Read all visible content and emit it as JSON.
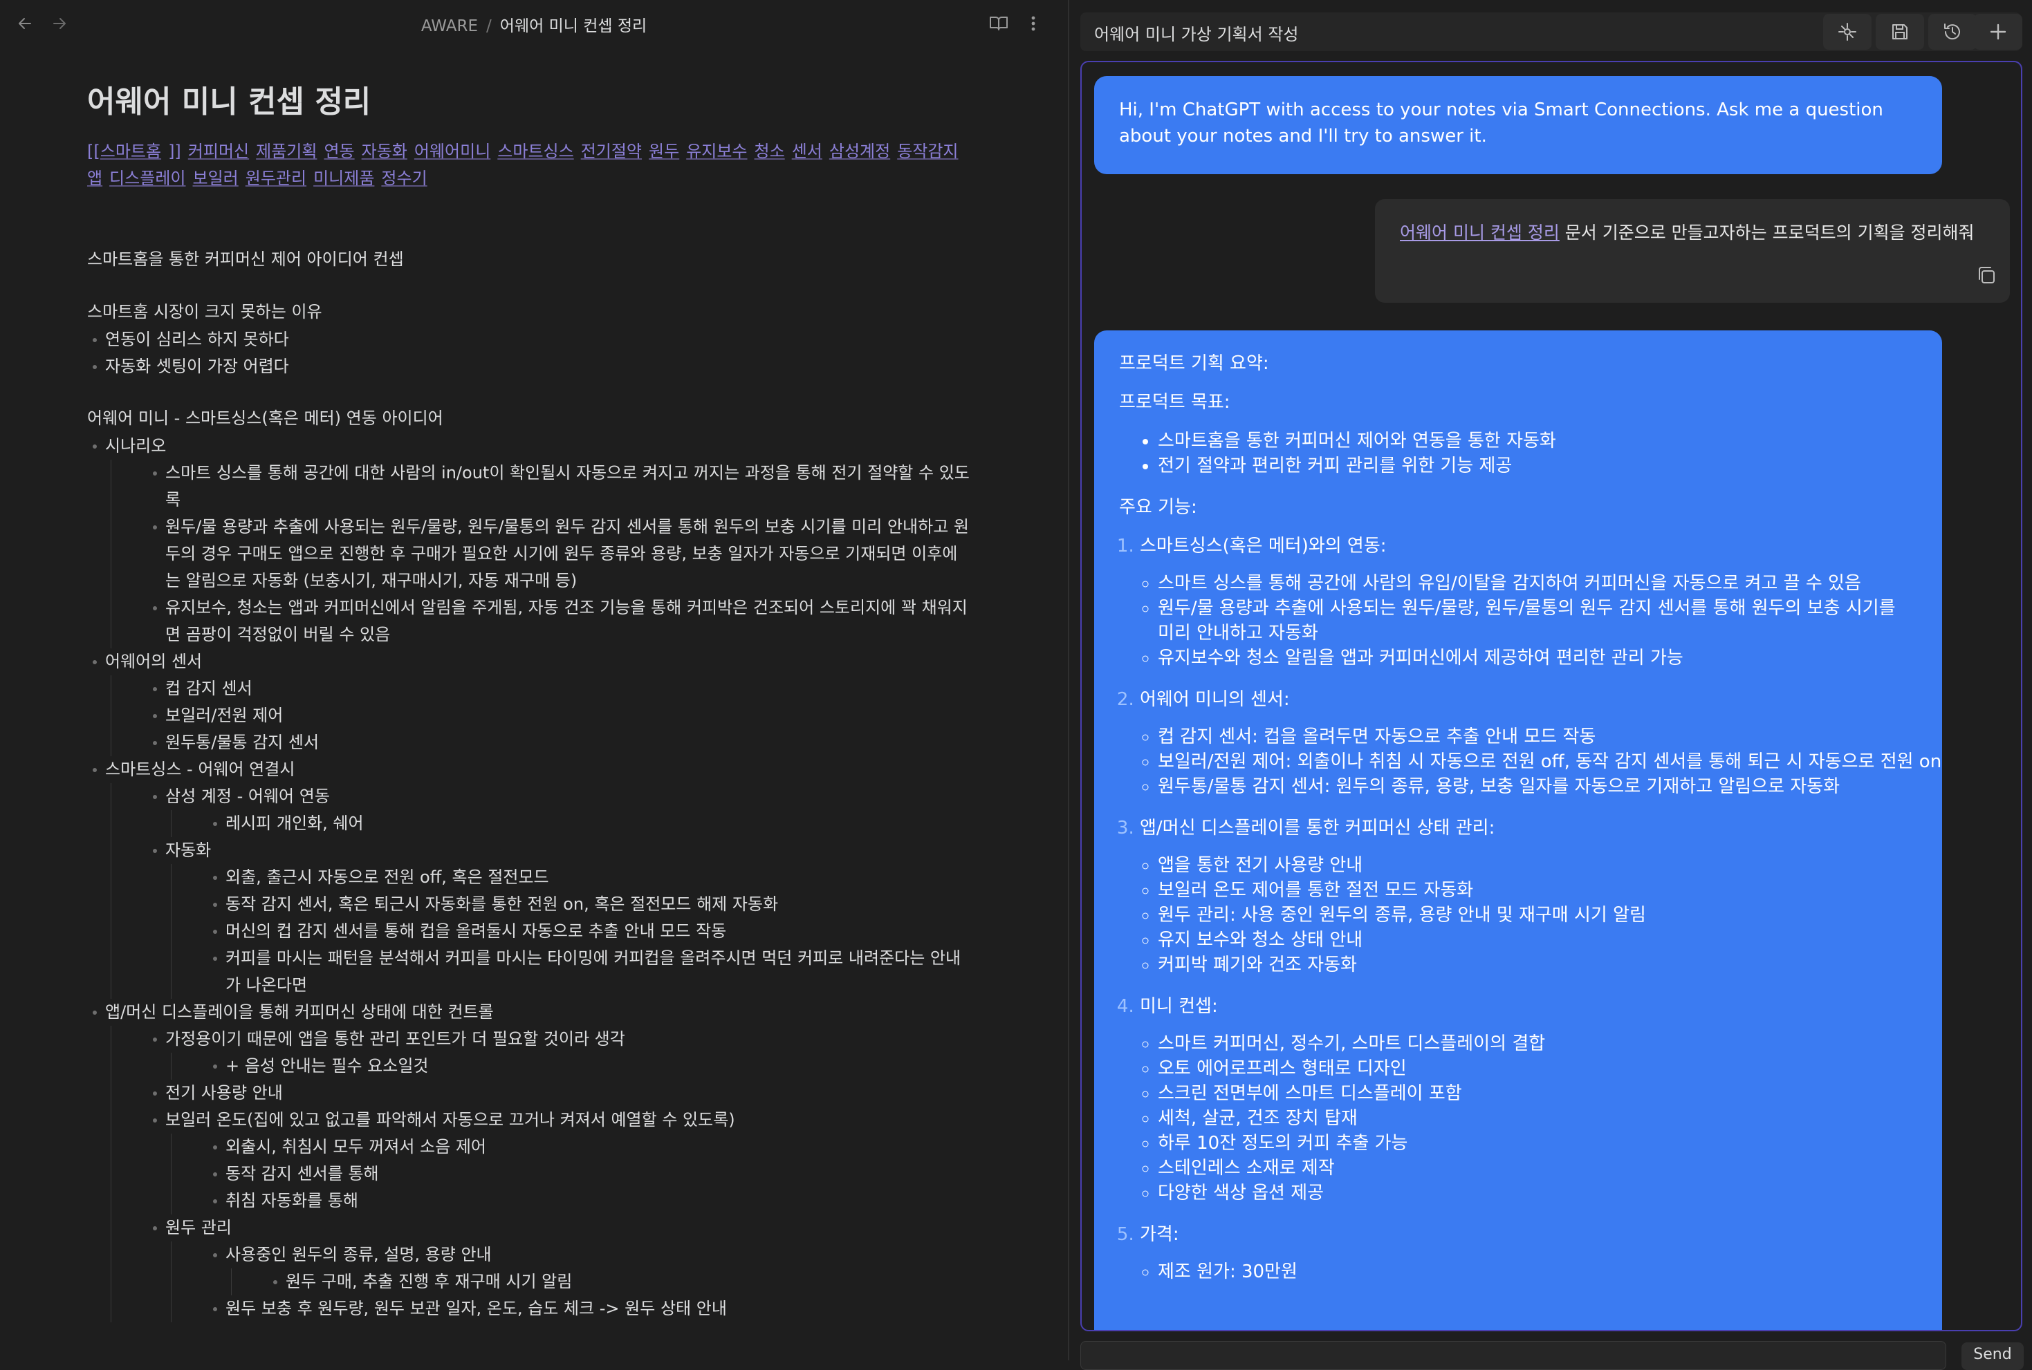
{
  "header": {
    "breadcrumb_root": "AWARE",
    "breadcrumb_sep": "/",
    "breadcrumb_current": "어웨어 미니 컨셉 정리"
  },
  "note": {
    "title": "어웨어 미니 컨셉 정리",
    "tags_open": "[[",
    "tags_first": "스마트홈",
    "tags_close": "]]",
    "tags": [
      "커피머신",
      "제품기획",
      "연동",
      "자동화",
      "어웨어미니",
      "스마트싱스",
      "전기절약",
      "원두",
      "유지보수",
      "청소",
      "센서",
      "삼성계정",
      "동작감지",
      "앱",
      "디스플레이",
      "보일러",
      "원두관리",
      "미니제품",
      "정수기"
    ],
    "intro": "스마트홈을 통한 커피머신 제어 아이디어 컨셉",
    "why_title": "스마트홈 시장이 크지 못하는 이유",
    "why_items": [
      "연동이 심리스 하지 못하다",
      "자동화 셋팅이 가장 어렵다"
    ],
    "idea_title": "어웨어 미니 - 스마트싱스(혹은 메터) 연동 아이디어",
    "l_scenario": "시나리오",
    "l_scenario_1": "스마트 싱스를 통해 공간에 대한 사람의 in/out이 확인될시  자동으로 켜지고 꺼지는 과정을 통해 전기 절약할 수 있도록",
    "l_scenario_2": "원두/물 용량과 추출에 사용되는 원두/물량, 원두/물통의 원두 감지 센서를 통해 원두의 보충 시기를 미리 안내하고 원두의 경우 구매도 앱으로 진행한 후 구매가 필요한 시기에 원두 종류와 용량, 보충 일자가 자동으로 기재되면 이후에는 알림으로 자동화 (보충시기, 재구매시기, 자동 재구매 등)",
    "l_scenario_3": "유지보수, 청소는 앱과 커피머신에서 알림을 주게됨, 자동 건조 기능을 통해 커피박은 건조되어 스토리지에 꽉 채워지면 곰팡이 걱정없이 버릴 수 있음",
    "l_sensor": "어웨어의 센서",
    "l_sensor_1": "컵 감지 센서",
    "l_sensor_2": "보일러/전원 제어",
    "l_sensor_3": "원두통/물통 감지 센서",
    "l_st": "스마트싱스 - 어웨어 연결시",
    "l_st_1": "삼성 계정 - 어웨어 연동",
    "l_st_1_1": "레시피 개인화, 쉐어",
    "l_st_2": "자동화",
    "l_st_2_1": "외출, 출근시 자동으로 전원 off, 혹은 절전모드",
    "l_st_2_2": "동작 감지 센서, 혹은 퇴근시 자동화를 통한 전원 on, 혹은 절전모드 해제 자동화",
    "l_st_2_3": "머신의 컵 감지 센서를 통해 컵을 올려둘시 자동으로 추출 안내 모드 작동",
    "l_st_2_4": "커피를 마시는 패턴을 분석해서 커피를 마시는 타이밍에 커피컵을 올려주시면 먹던 커피로 내려준다는 안내가 나온다면",
    "l_app": "앱/머신 디스플레이을 통해 커피머신 상태에 대한 컨트롤",
    "l_app_1": "가정용이기 때문에 앱을 통한 관리 포인트가 더 필요할 것이라 생각",
    "l_app_1_1": "+ 음성 안내는 필수 요소일것",
    "l_app_2": "전기 사용량 안내",
    "l_app_3": "보일러 온도(집에 있고 없고를 파악해서 자동으로 끄거나 켜져서 예열할 수 있도록)",
    "l_app_3_1": "외출시, 취침시 모두 꺼져서 소음 제어",
    "l_app_3_2": "동작 감지 센서를 통해",
    "l_app_3_3": "취침 자동화를 통해",
    "l_app_4": "원두 관리",
    "l_app_4_1": "사용중인 원두의 종류, 설명, 용량 안내",
    "l_app_4_1_1": "원두 구매, 추출 진행 후 재구매 시기 알림",
    "l_app_4_2": "원두 보충 후 원두량, 원두 보관 일자, 온도, 습도 체크 -> 원두 상태 안내"
  },
  "chat": {
    "title": "어웨어 미니 가상 기획서 작성",
    "intro": "Hi, I'm ChatGPT with access to your notes via Smart Connections. Ask me a question about your notes and I'll try to answer it.",
    "user_link": "어웨어 미니 컨셉 정리",
    "user_text": " 문서 기준으로 만들고자하는 프로덕트의 기획을 정리해줘",
    "summary_h": "프로덕트 기획 요약:",
    "goal_h": "프로덕트 목표:",
    "goal_1": "스마트홈을 통한 커피머신 제어와 연동을 통한 자동화",
    "goal_2": "전기 절약과 편리한 커피 관리를 위한 기능 제공",
    "feat_h": "주요 기능:",
    "f1": "스마트싱스(혹은 메터)와의 연동:",
    "f1_1": "스마트 싱스를 통해 공간에 사람의 유입/이탈을 감지하여 커피머신을 자동으로 켜고 끌 수 있음",
    "f1_2": "원두/물 용량과 추출에 사용되는 원두/물량, 원두/물통의 원두 감지 센서를 통해 원두의 보충 시기를 미리 안내하고 자동화",
    "f1_3": "유지보수와 청소 알림을 앱과 커피머신에서 제공하여 편리한 관리 가능",
    "f2": "어웨어 미니의 센서:",
    "f2_1": "컵 감지 센서: 컵을 올려두면 자동으로 추출 안내 모드 작동",
    "f2_2": "보일러/전원 제어: 외출이나 취침 시 자동으로 전원 off, 동작 감지 센서를 통해 퇴근 시 자동으로 전원 on",
    "f2_3": "원두통/물통 감지 센서: 원두의 종류, 용량, 보충 일자를 자동으로 기재하고 알림으로 자동화",
    "f3": "앱/머신 디스플레이를 통한 커피머신 상태 관리:",
    "f3_1": "앱을 통한 전기 사용량 안내",
    "f3_2": "보일러 온도 제어를 통한 절전 모드 자동화",
    "f3_3": "원두 관리: 사용 중인 원두의 종류, 용량 안내 및 재구매 시기 알림",
    "f3_4": "유지 보수와 청소 상태 안내",
    "f3_5": "커피박 폐기와 건조 자동화",
    "f4": "미니 컨셉:",
    "f4_1": "스마트 커피머신, 정수기, 스마트 디스플레이의 결합",
    "f4_2": "오토 에어로프레스 형태로 디자인",
    "f4_3": "스크린 전면부에 스마트 디스플레이 포함",
    "f4_4": "세척, 살균, 건조 장치 탑재",
    "f4_5": "하루 10잔 정도의 커피 추출 가능",
    "f4_6": "스테인레스 소재로 제작",
    "f4_7": "다양한 색상 옵션 제공",
    "f5": "가격:",
    "f5_1": "제조 원가: 30만원",
    "send_label": "Send"
  },
  "colors": {
    "background": "#1e1e1e",
    "bubble_blue": "#3b7bf2",
    "tag_purple": "#8b7fd6",
    "frame_accent": "#4a3fb0"
  }
}
